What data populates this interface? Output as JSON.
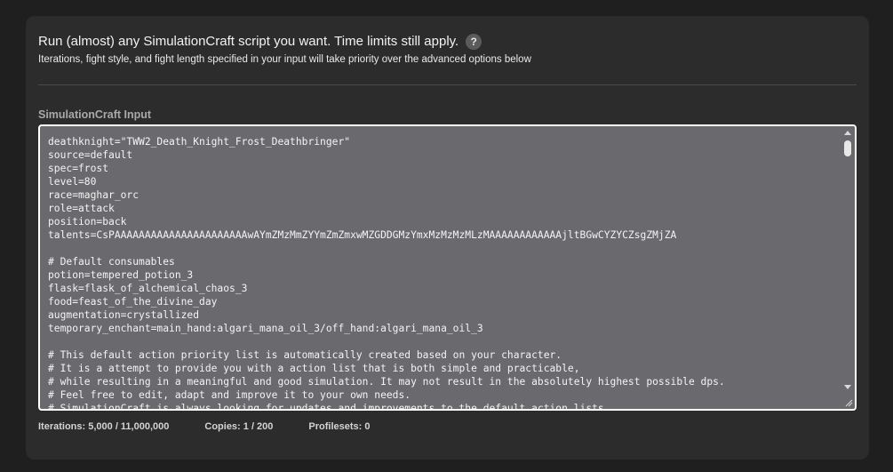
{
  "header": {
    "title": "Run (almost) any SimulationCraft script you want. Time limits still apply.",
    "help_glyph": "?",
    "subtitle": "Iterations, fight style, and fight length specified in your input will take priority over the advanced options below"
  },
  "input": {
    "label": "SimulationCraft Input",
    "lines": [
      "deathknight=\"TWW2_Death_Knight_Frost_Deathbringer\"",
      "source=default",
      "spec=frost",
      "level=80",
      "race=maghar_orc",
      "role=attack",
      "position=back",
      "talents=CsPAAAAAAAAAAAAAAAAAAAAAAwAYmZMzMmZYYmZmZmxwMZGDDGMzYmxMzMzMzMLzMAAAAAAAAAAAAjltBGwCYZYCZsgZMjZA",
      "",
      "# Default consumables",
      "potion=tempered_potion_3",
      "flask=flask_of_alchemical_chaos_3",
      "food=feast_of_the_divine_day",
      "augmentation=crystallized",
      "temporary_enchant=main_hand:algari_mana_oil_3/off_hand:algari_mana_oil_3",
      "",
      "# This default action priority list is automatically created based on your character.",
      "# It is a attempt to provide you with a action list that is both simple and practicable,",
      "# while resulting in a meaningful and good simulation. It may not result in the absolutely highest possible dps.",
      "# Feel free to edit, adapt and improve it to your own needs.",
      "# SimulationCraft is always looking for updates and improvements to the default action lists."
    ]
  },
  "stats": {
    "iterations": "Iterations: 5,000 / 11,000,000",
    "copies": "Copies: 1 / 200",
    "profilesets": "Profilesets: 0"
  },
  "colors": {
    "page_bg": "#1f1f1f",
    "card_bg": "#2c2c2d",
    "editor_bg": "#6a696d",
    "label": "#a9a9aa"
  }
}
